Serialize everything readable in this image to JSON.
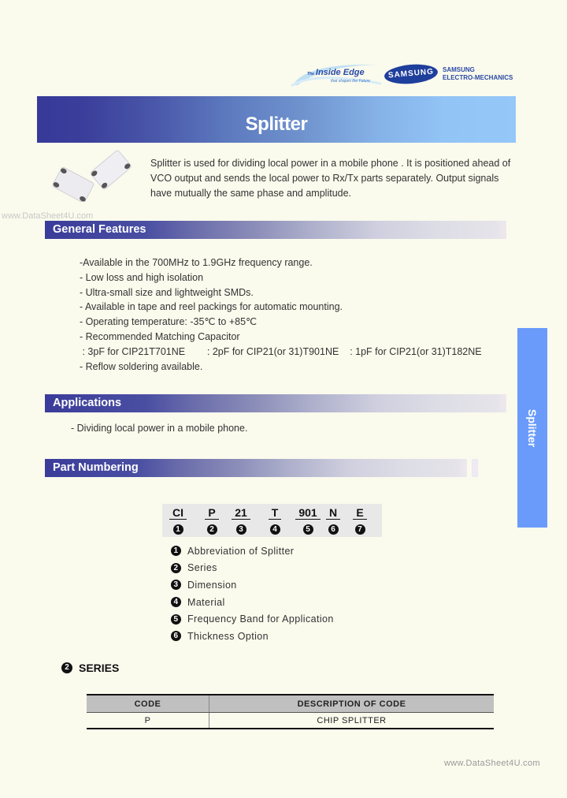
{
  "logos": {
    "inside_edge_prefix": "The",
    "inside_edge": "Inside Edge",
    "inside_edge_tagline": "that shapes the Future",
    "samsung_oval": "SAMSUNG",
    "company_line1": "SAMSUNG",
    "company_line2": "ELECTRO-MECHANICS"
  },
  "title": "Splitter",
  "intro": "Splitter is used for dividing local power in a mobile phone . It is positioned ahead of VCO output and sends the local power to Rx/Tx parts separately. Output signals have mutually the same phase and amplitude.",
  "watermark_top": "www.DataSheet4U.com",
  "sections": {
    "general_features": "General Features",
    "applications": "Applications",
    "part_numbering": "Part Numbering"
  },
  "features": [
    "-Available in the 700MHz to 1.9GHz frequency range.",
    "- Low loss and high isolation",
    "- Ultra-small size and lightweight SMDs.",
    "- Available in tape and reel packings for automatic mounting.",
    "- Operating temperature: -35℃ to +85℃",
    "- Recommended Matching Capacitor",
    " : 3pF for CIP21T701NE        : 2pF for CIP21(or 31)T901NE    : 1pF for CIP21(or 31)T182NE",
    "- Reflow soldering available."
  ],
  "applications": [
    "- Dividing local power in a mobile phone."
  ],
  "side_tab": "Splitter",
  "part_number": {
    "codes": [
      "CI",
      "P",
      "21",
      "T",
      "901",
      "N",
      "E"
    ],
    "numbers": [
      "1",
      "2",
      "3",
      "4",
      "5",
      "6",
      "7"
    ]
  },
  "legend": [
    {
      "num": "1",
      "label": "Abbreviation of Splitter"
    },
    {
      "num": "2",
      "label": "Series"
    },
    {
      "num": "3",
      "label": "Dimension"
    },
    {
      "num": "4",
      "label": "Material"
    },
    {
      "num": "5",
      "label": "Frequency Band for Application"
    },
    {
      "num": "6",
      "label": "Thickness Option"
    }
  ],
  "series": {
    "num": "2",
    "title": "SERIES",
    "headers": [
      "CODE",
      "DESCRIPTION OF CODE"
    ],
    "rows": [
      [
        "P",
        "CHIP SPLITTER"
      ]
    ]
  },
  "watermark_bottom": "www.DataSheet4U.com"
}
